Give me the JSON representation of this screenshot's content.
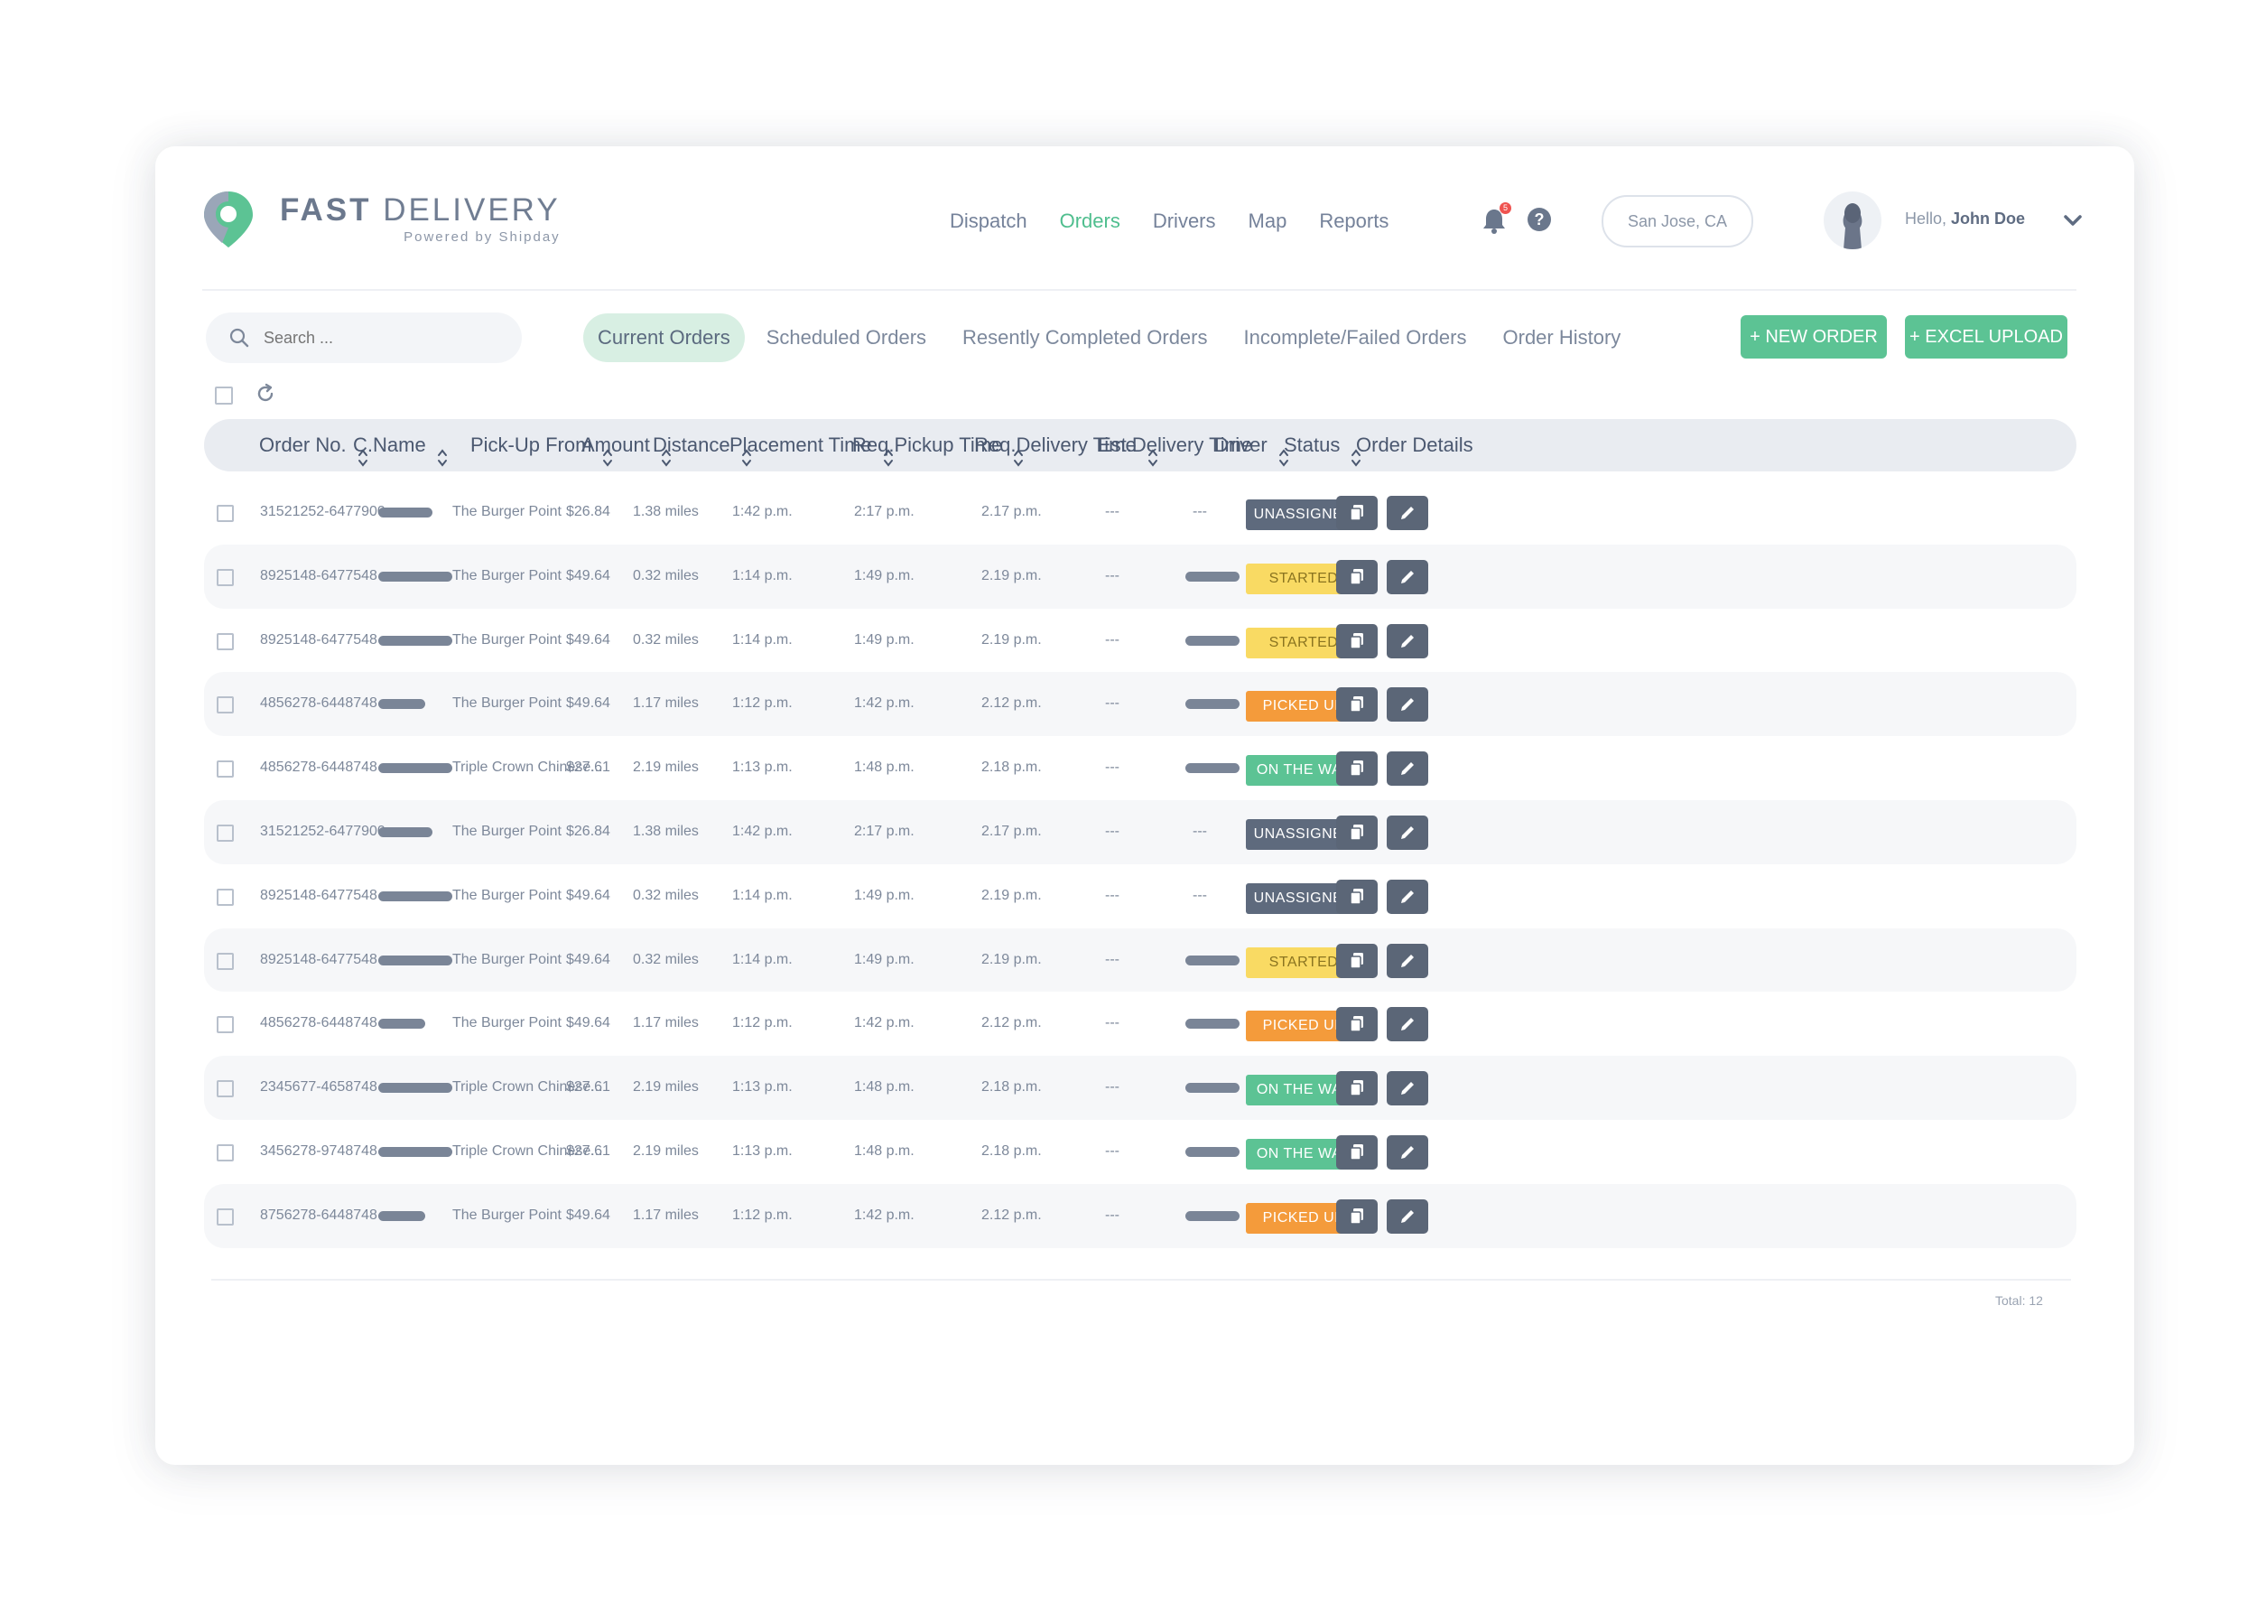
{
  "brand": {
    "title_bold": "FAST",
    "title_rest": "DELIVERY",
    "subtitle": "Powered by Shipday",
    "accent": "#4fbe8e"
  },
  "nav": [
    {
      "label": "Dispatch",
      "active": false
    },
    {
      "label": "Orders",
      "active": true
    },
    {
      "label": "Drivers",
      "active": false
    },
    {
      "label": "Map",
      "active": false
    },
    {
      "label": "Reports",
      "active": false
    }
  ],
  "header": {
    "notification_count": "5",
    "help_icon": "question-icon",
    "location": "San Jose, CA",
    "greeting": "Hello,",
    "user_name": "John Doe"
  },
  "toolbar": {
    "search_placeholder": "Search ...",
    "tabs": [
      {
        "label": "Current Orders",
        "active": true
      },
      {
        "label": "Scheduled Orders",
        "active": false
      },
      {
        "label": "Resently Completed Orders",
        "active": false
      },
      {
        "label": "Incomplete/Failed Orders",
        "active": false
      },
      {
        "label": "Order History",
        "active": false
      }
    ],
    "new_order_label": "+ NEW ORDER",
    "excel_upload_label": "+ EXCEL UPLOAD"
  },
  "table": {
    "columns": [
      "Order No.",
      "C.Name",
      "Pick-Up From",
      "Amount",
      "Distance",
      "Placement Time",
      "Req.Pickup Time",
      "Req.Delivery Time",
      "Est.Delivery Time",
      "Driver",
      "Status",
      "Order Details"
    ],
    "rows": [
      {
        "order_no": "31521252-6477900",
        "pickup": "The Burger Point",
        "amount": "$26.84",
        "distance": "1.38 miles",
        "placement": "1:42 p.m.",
        "req_pickup": "2:17 p.m.",
        "req_delivery": "2.17 p.m.",
        "est_delivery": "---",
        "driver": "---",
        "status": "UNASSIGNED"
      },
      {
        "order_no": "8925148-6477548",
        "pickup": "The Burger Point",
        "amount": "$49.64",
        "distance": "0.32 miles",
        "placement": "1:14 p.m.",
        "req_pickup": "1:49 p.m.",
        "req_delivery": "2.19 p.m.",
        "est_delivery": "---",
        "driver": "",
        "status": "STARTED"
      },
      {
        "order_no": "8925148-6477548",
        "pickup": "The Burger Point",
        "amount": "$49.64",
        "distance": "0.32 miles",
        "placement": "1:14 p.m.",
        "req_pickup": "1:49 p.m.",
        "req_delivery": "2.19 p.m.",
        "est_delivery": "---",
        "driver": "",
        "status": "STARTED"
      },
      {
        "order_no": "4856278-6448748",
        "pickup": "The Burger Point",
        "amount": "$49.64",
        "distance": "1.17 miles",
        "placement": "1:12 p.m.",
        "req_pickup": "1:42 p.m.",
        "req_delivery": "2.12 p.m.",
        "est_delivery": "---",
        "driver": "",
        "status": "PICKED UP"
      },
      {
        "order_no": "4856278-6448748",
        "pickup": "Triple Crown Chinese...",
        "amount": "$27.61",
        "distance": "2.19 miles",
        "placement": "1:13 p.m.",
        "req_pickup": "1:48 p.m.",
        "req_delivery": "2.18 p.m.",
        "est_delivery": "---",
        "driver": "",
        "status": "ON THE WAY"
      },
      {
        "order_no": "31521252-6477900",
        "pickup": "The Burger Point",
        "amount": "$26.84",
        "distance": "1.38 miles",
        "placement": "1:42 p.m.",
        "req_pickup": "2:17 p.m.",
        "req_delivery": "2.17 p.m.",
        "est_delivery": "---",
        "driver": "---",
        "status": "UNASSIGNED"
      },
      {
        "order_no": "8925148-6477548",
        "pickup": "The Burger Point",
        "amount": "$49.64",
        "distance": "0.32 miles",
        "placement": "1:14 p.m.",
        "req_pickup": "1:49 p.m.",
        "req_delivery": "2.19 p.m.",
        "est_delivery": "---",
        "driver": "---",
        "status": "UNASSIGNED"
      },
      {
        "order_no": "8925148-6477548",
        "pickup": "The Burger Point",
        "amount": "$49.64",
        "distance": "0.32 miles",
        "placement": "1:14 p.m.",
        "req_pickup": "1:49 p.m.",
        "req_delivery": "2.19 p.m.",
        "est_delivery": "---",
        "driver": "",
        "status": "STARTED"
      },
      {
        "order_no": "4856278-6448748",
        "pickup": "The Burger Point",
        "amount": "$49.64",
        "distance": "1.17 miles",
        "placement": "1:12 p.m.",
        "req_pickup": "1:42 p.m.",
        "req_delivery": "2.12 p.m.",
        "est_delivery": "---",
        "driver": "",
        "status": "PICKED UP"
      },
      {
        "order_no": "2345677-4658748",
        "pickup": "Triple Crown Chinese...",
        "amount": "$27.61",
        "distance": "2.19 miles",
        "placement": "1:13 p.m.",
        "req_pickup": "1:48 p.m.",
        "req_delivery": "2.18 p.m.",
        "est_delivery": "---",
        "driver": "",
        "status": "ON THE WAY"
      },
      {
        "order_no": "3456278-9748748",
        "pickup": "Triple Crown Chinese...",
        "amount": "$27.61",
        "distance": "2.19 miles",
        "placement": "1:13 p.m.",
        "req_pickup": "1:48 p.m.",
        "req_delivery": "2.18 p.m.",
        "est_delivery": "---",
        "driver": "",
        "status": "ON THE WAY"
      },
      {
        "order_no": "8756278-6448748",
        "pickup": "The Burger Point",
        "amount": "$49.64",
        "distance": "1.17 miles",
        "placement": "1:12 p.m.",
        "req_pickup": "1:42 p.m.",
        "req_delivery": "2.12 p.m.",
        "est_delivery": "---",
        "driver": "",
        "status": "PICKED UP"
      }
    ],
    "status_colors": {
      "UNASSIGNED": "#5e6a7d",
      "STARTED": "#f9da63",
      "PICKED UP": "#f49b3b",
      "ON THE WAY": "#5cc394"
    },
    "action_icons": [
      "copy-icon",
      "edit-icon"
    ]
  },
  "footer": {
    "total": "Total: 12"
  }
}
